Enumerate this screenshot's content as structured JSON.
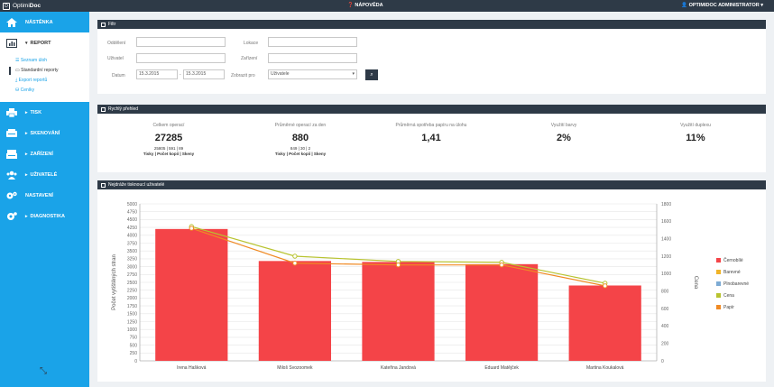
{
  "app": {
    "brand_prefix": "Optimi",
    "brand_suffix": "Doc",
    "logo_letter": "D"
  },
  "header": {
    "help_label": "NÁPOVĚDA",
    "user_label": "OPTIMIDOC ADMINISTRATOR"
  },
  "sidebar": {
    "items": [
      {
        "label": "NÁSTĚNKA"
      },
      {
        "label": "REPORT"
      },
      {
        "label": "TISK"
      },
      {
        "label": "SKENOVÁNÍ"
      },
      {
        "label": "ZAŘÍZENÍ"
      },
      {
        "label": "UŽIVATELÉ"
      },
      {
        "label": "NASTAVENÍ"
      },
      {
        "label": "DIAGNOSTIKA"
      }
    ],
    "report_sub": [
      "Seznam úloh",
      "Standardní reporty",
      "Export reportů",
      "Ceníky"
    ]
  },
  "filter": {
    "title": "Filtr",
    "department_label": "Oddělení",
    "user_label": "Uživatel",
    "date_label": "Datum",
    "date_from": "15.3.2015",
    "date_to": "15.3.2015",
    "location_label": "Lokace",
    "device_label": "Zařízení",
    "display_label": "Zobrazit pro",
    "display_value": "Uživatele"
  },
  "overview": {
    "title": "Rychlý přehled",
    "stats": [
      {
        "title": "Celkem operací",
        "value": "27285",
        "sub": "25805 | 591 | 89",
        "sub2": "Tisky | Počet kopií | Skeny"
      },
      {
        "title": "Průměrné operací za den",
        "value": "880",
        "sub": "849 | 30 | 2",
        "sub2": "Tisky | Počet kopií | Skeny"
      },
      {
        "title": "Průměrná spotřeba papíru na úlohu",
        "value": "1,41",
        "sub": "",
        "sub2": ""
      },
      {
        "title": "Využití barvy",
        "value": "2%",
        "sub": "",
        "sub2": ""
      },
      {
        "title": "Využití duplexu",
        "value": "11%",
        "sub": "",
        "sub2": ""
      }
    ]
  },
  "chart_panel": {
    "title": "Nejdráže tisknoucí uživatelé"
  },
  "chart_data": {
    "type": "bar",
    "categories": [
      "Irena Hašková",
      "Miloš Svozoomek",
      "Kateřina Jandová",
      "Eduard Matějček",
      "Martina Koukalová"
    ],
    "series": [
      {
        "name": "Černobílé",
        "type": "bar",
        "axis": "left",
        "color": "#f44448",
        "values": [
          4200,
          3180,
          3150,
          3080,
          2400
        ]
      },
      {
        "name": "Barevné",
        "type": "line",
        "axis": "left",
        "color": "#f0b429",
        "values": []
      },
      {
        "name": "Plnobarevné",
        "type": "line",
        "axis": "left",
        "color": "#7dabd4",
        "values": []
      },
      {
        "name": "Cena",
        "type": "line",
        "axis": "right",
        "color": "#b8c32f",
        "values": [
          1540,
          1200,
          1140,
          1130,
          890
        ]
      },
      {
        "name": "Papír",
        "type": "line",
        "axis": "right",
        "color": "#f08a24",
        "values": [
          1520,
          1120,
          1100,
          1100,
          860
        ]
      }
    ],
    "ylabel": "Počet vytištěných stran",
    "y2label": "Cena",
    "ylim": [
      0,
      5000
    ],
    "yticks": [
      "0",
      "250",
      "500",
      "750",
      "1000",
      "1250",
      "1500",
      "1750",
      "2000",
      "2250",
      "2500",
      "2750",
      "3000",
      "3250",
      "3500",
      "3750",
      "4000",
      "4250",
      "4500",
      "4750",
      "5000"
    ],
    "y2lim": [
      0,
      1800
    ],
    "y2ticks": [
      "0",
      "200",
      "400",
      "600",
      "800",
      "1000",
      "1200",
      "1400",
      "1600",
      "1800"
    ],
    "grid": true,
    "legend": "right"
  }
}
